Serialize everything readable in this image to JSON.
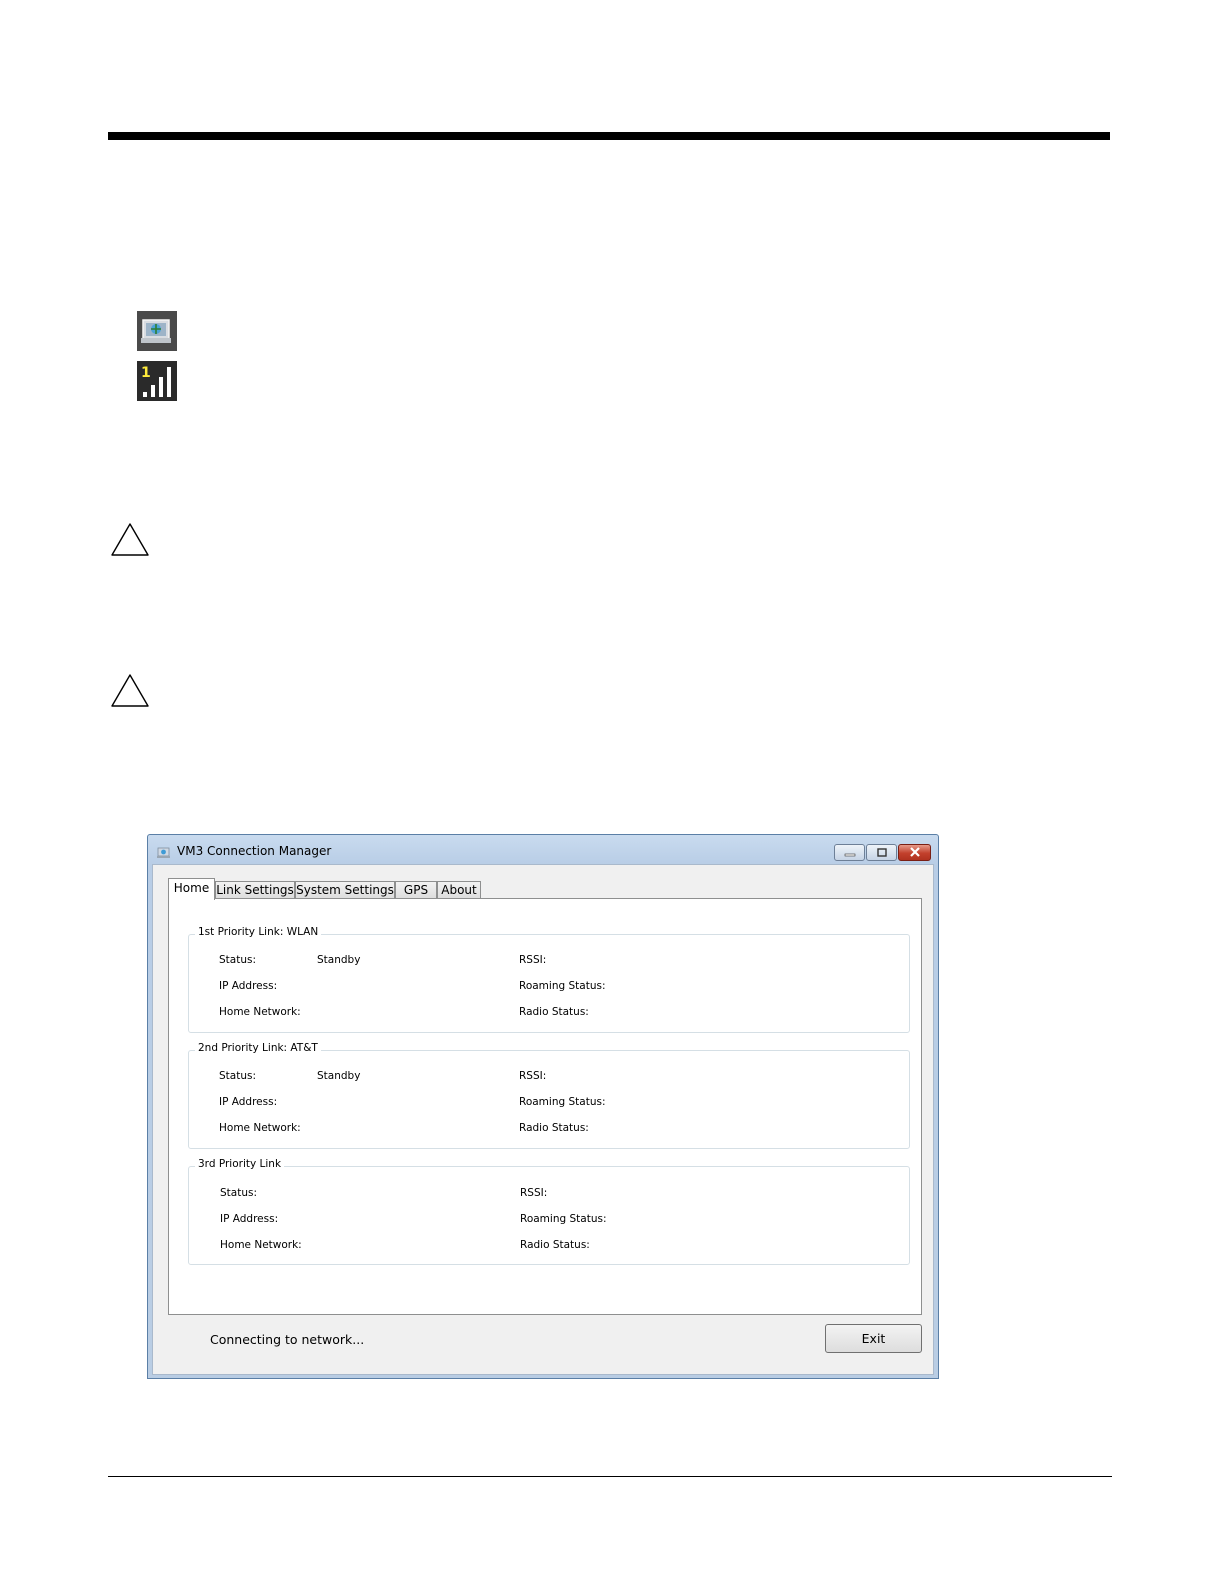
{
  "window": {
    "title": "VM3 Connection Manager",
    "controls": [
      "minimize-icon",
      "maximize-icon",
      "close-icon"
    ]
  },
  "tabs": [
    {
      "label": "Home",
      "active": true
    },
    {
      "label": "Link Settings"
    },
    {
      "label": "System Settings"
    },
    {
      "label": "GPS"
    },
    {
      "label": "About"
    }
  ],
  "groups": [
    {
      "title": "1st Priority Link: WLAN",
      "status_label": "Status:",
      "status_value": "Standby",
      "ip_label": "IP Address:",
      "home_label": "Home Network:",
      "rssi_label": "RSSI:",
      "roaming_label": "Roaming Status:",
      "radio_label": "Radio Status:"
    },
    {
      "title": "2nd Priority Link: AT&T",
      "status_label": "Status:",
      "status_value": "Standby",
      "ip_label": "IP Address:",
      "home_label": "Home Network:",
      "rssi_label": "RSSI:",
      "roaming_label": "Roaming Status:",
      "radio_label": "Radio Status:"
    },
    {
      "title": "3rd Priority Link",
      "status_label": "Status:",
      "status_value": "",
      "ip_label": "IP Address:",
      "home_label": "Home Network:",
      "rssi_label": "RSSI:",
      "roaming_label": "Roaming Status:",
      "radio_label": "Radio Status:"
    }
  ],
  "footer": {
    "status": "Connecting to network...",
    "exit_label": "Exit"
  },
  "icons": {
    "connection_manager": "connection-manager-icon",
    "signal": "signal-strength-icon",
    "caution": "caution-icon"
  }
}
